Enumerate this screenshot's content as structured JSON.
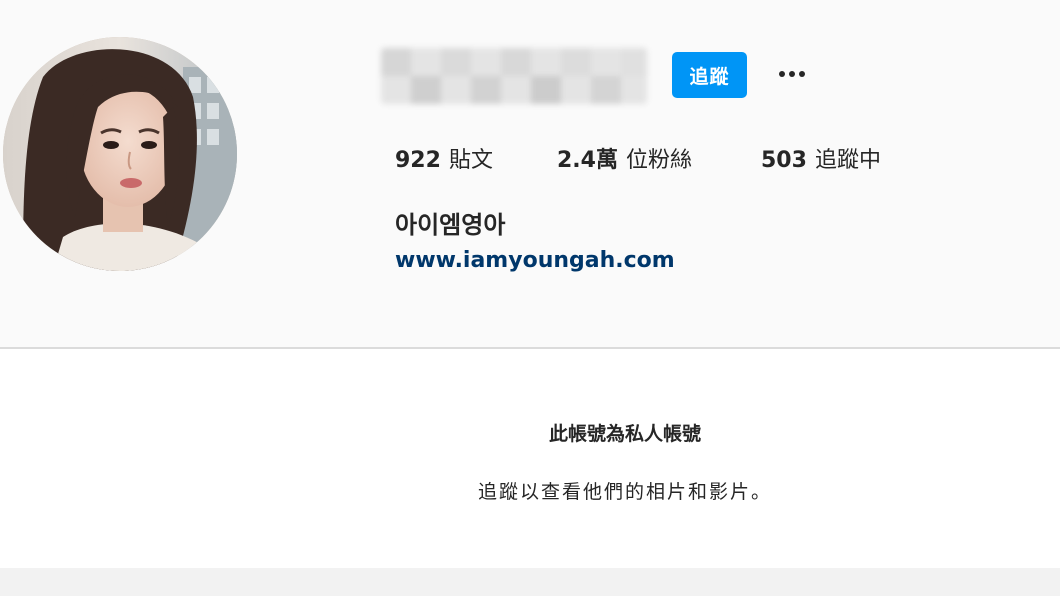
{
  "profile": {
    "follow_label": "追蹤",
    "more_icon": "more-horizontal-icon",
    "stats": {
      "posts_count": "922",
      "posts_label": "貼文",
      "followers_count": "2.4萬",
      "followers_label": "位粉絲",
      "following_count": "503",
      "following_label": "追蹤中"
    },
    "display_name": "아이엠영아",
    "website": "www.iamyoungah.com"
  },
  "private_notice": {
    "title": "此帳號為私人帳號",
    "subtitle": "追蹤以查看他們的相片和影片。"
  },
  "colors": {
    "accent": "#0095f6",
    "link": "#00376b",
    "text": "#262626",
    "background": "#fafafa",
    "divider": "#dbdbdb"
  }
}
